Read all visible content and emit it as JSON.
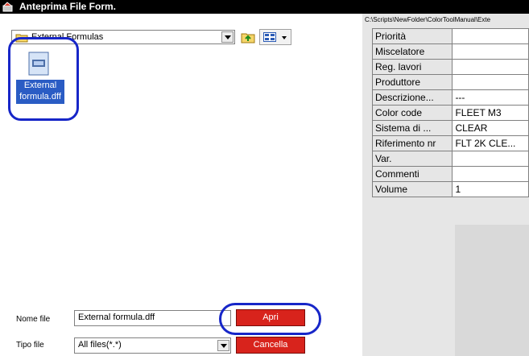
{
  "window": {
    "title": "Anteprima File Form."
  },
  "toolbar": {
    "folder_label": "External Formulas"
  },
  "files": [
    {
      "name": "External formula.dff",
      "icon": "dff-file-icon",
      "selected": true
    }
  ],
  "form": {
    "filename_label": "Nome file",
    "filename_value": "External formula.dff",
    "filetype_label": "Tipo file",
    "filetype_value": "All files(*.*)",
    "open_label": "Apri",
    "cancel_label": "Cancella"
  },
  "details": {
    "path": "C:\\Scripts\\NewFolder\\ColorToolManual\\Exte",
    "rows": [
      {
        "key": "Priorità",
        "value": ""
      },
      {
        "key": "Miscelatore",
        "value": ""
      },
      {
        "key": "Reg. lavori",
        "value": ""
      },
      {
        "key": "Produttore",
        "value": ""
      },
      {
        "key": "Descrizione...",
        "value": "---"
      },
      {
        "key": "Color code",
        "value": "FLEET M3"
      },
      {
        "key": "Sistema di ...",
        "value": "CLEAR"
      },
      {
        "key": "Riferimento nr",
        "value": "FLT 2K CLE..."
      },
      {
        "key": "Var.",
        "value": ""
      },
      {
        "key": "Commenti",
        "value": ""
      },
      {
        "key": "Volume",
        "value": "1"
      }
    ]
  },
  "colors": {
    "title_bg": "#000000",
    "selection": "#2a5cc4",
    "button_red": "#d8231c",
    "annotation_oval": "#1726c8"
  }
}
